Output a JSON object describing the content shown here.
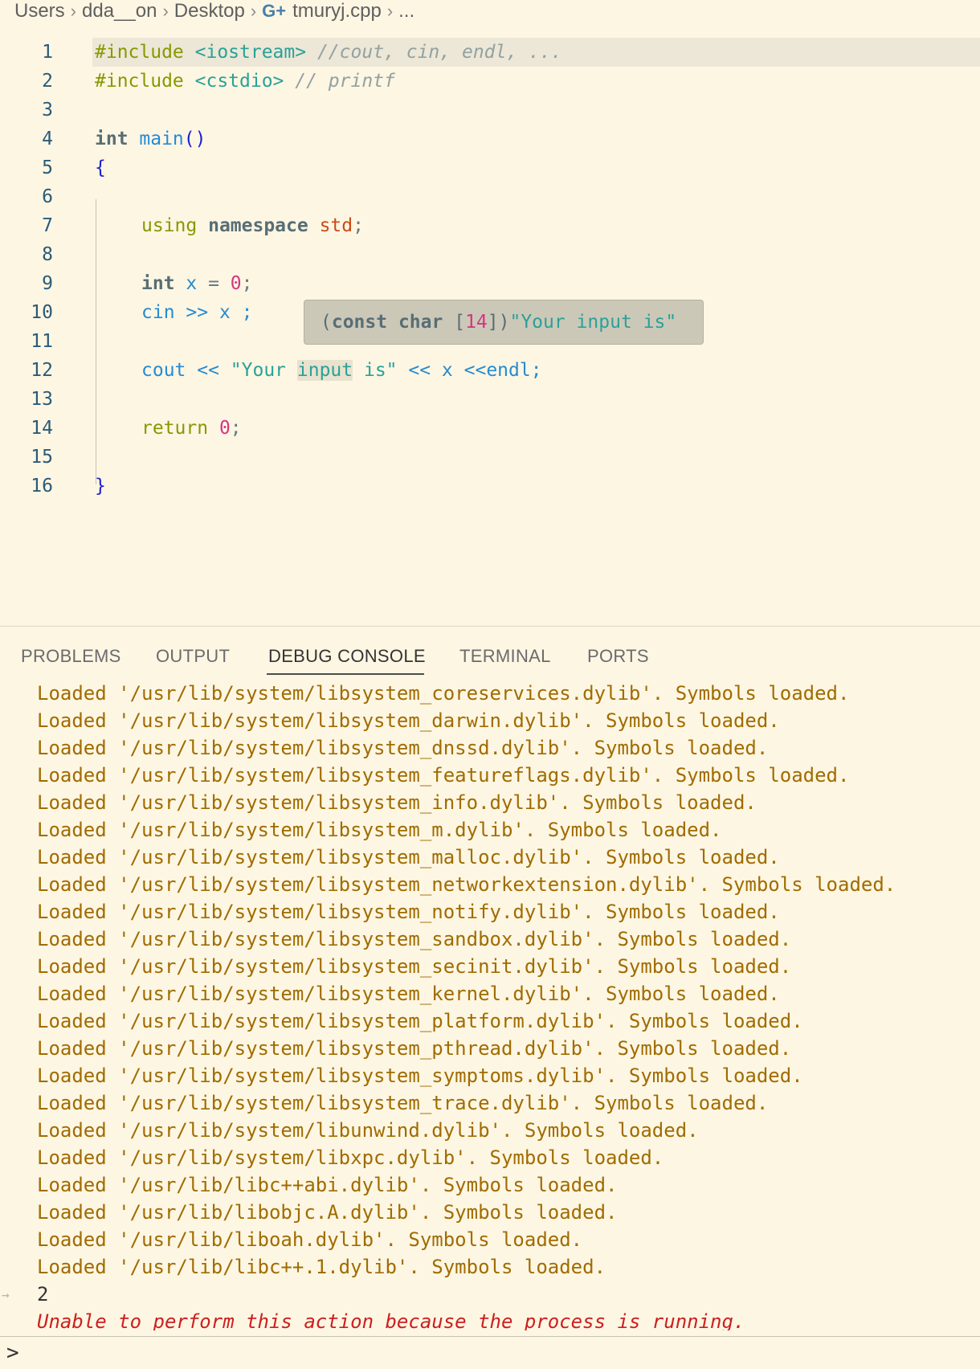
{
  "breadcrumb": {
    "items": [
      "Users",
      "dda__on",
      "Desktop"
    ],
    "file_icon": "cpp-file-icon",
    "file_icon_glyph": "G+",
    "file": "tmuryj.cpp",
    "ellipsis": "..."
  },
  "editor": {
    "line_numbers": [
      "1",
      "2",
      "3",
      "4",
      "5",
      "6",
      "7",
      "8",
      "9",
      "10",
      "11",
      "12",
      "13",
      "14",
      "15",
      "16"
    ],
    "lines": {
      "l1": {
        "pre": "#include",
        "inc": " <iostream>",
        "com": " //cout, cin, endl, ..."
      },
      "l2": {
        "pre": "#include",
        "inc": " <cstdio>",
        "com": " // printf"
      },
      "l4": {
        "kw": "int",
        "fn": " main",
        "br": "()"
      },
      "l5": {
        "br": "{"
      },
      "l7": {
        "kw2": "using",
        "kw": " namespace",
        "ns": " std",
        "op": ";"
      },
      "l9": {
        "kw": "int",
        "id": " x",
        "op": " = ",
        "num": "0",
        "op2": ";"
      },
      "l10": {
        "id": "cin",
        "op": " >> ",
        "id2": "x",
        "op2": " ;"
      },
      "l12": {
        "id": "cout",
        "op": " << ",
        "str": "\"Your ",
        "hl": "input",
        "str2": " is\"",
        "op2": " << ",
        "id2": "x",
        "op3": " <<",
        "id3": "endl",
        "op4": ";"
      },
      "l14": {
        "kw2": "return",
        "num": " 0",
        "op": ";"
      },
      "l16": {
        "br": "}"
      }
    },
    "hover": {
      "open": "(",
      "type": "const char",
      "sp": " ",
      "lb": "[",
      "num": "14",
      "rb": "])",
      "str": "\"Your input is\""
    }
  },
  "panel": {
    "tabs": [
      "PROBLEMS",
      "OUTPUT",
      "DEBUG CONSOLE",
      "TERMINAL",
      "PORTS"
    ],
    "active_tab": "DEBUG CONSOLE",
    "console_lines": [
      "Loaded '/usr/lib/system/libsystem_coreservices.dylib'. Symbols loaded.",
      "Loaded '/usr/lib/system/libsystem_darwin.dylib'. Symbols loaded.",
      "Loaded '/usr/lib/system/libsystem_dnssd.dylib'. Symbols loaded.",
      "Loaded '/usr/lib/system/libsystem_featureflags.dylib'. Symbols loaded.",
      "Loaded '/usr/lib/system/libsystem_info.dylib'. Symbols loaded.",
      "Loaded '/usr/lib/system/libsystem_m.dylib'. Symbols loaded.",
      "Loaded '/usr/lib/system/libsystem_malloc.dylib'. Symbols loaded.",
      "Loaded '/usr/lib/system/libsystem_networkextension.dylib'. Symbols loaded.",
      "Loaded '/usr/lib/system/libsystem_notify.dylib'. Symbols loaded.",
      "Loaded '/usr/lib/system/libsystem_sandbox.dylib'. Symbols loaded.",
      "Loaded '/usr/lib/system/libsystem_secinit.dylib'. Symbols loaded.",
      "Loaded '/usr/lib/system/libsystem_kernel.dylib'. Symbols loaded.",
      "Loaded '/usr/lib/system/libsystem_platform.dylib'. Symbols loaded.",
      "Loaded '/usr/lib/system/libsystem_pthread.dylib'. Symbols loaded.",
      "Loaded '/usr/lib/system/libsystem_symptoms.dylib'. Symbols loaded.",
      "Loaded '/usr/lib/system/libsystem_trace.dylib'. Symbols loaded.",
      "Loaded '/usr/lib/system/libunwind.dylib'. Symbols loaded.",
      "Loaded '/usr/lib/system/libxpc.dylib'. Symbols loaded.",
      "Loaded '/usr/lib/libc++abi.dylib'. Symbols loaded.",
      "Loaded '/usr/lib/libobjc.A.dylib'. Symbols loaded.",
      "Loaded '/usr/lib/liboah.dylib'. Symbols loaded.",
      "Loaded '/usr/lib/libc++.1.dylib'. Symbols loaded."
    ],
    "input_echo_arrow": "→",
    "input_echo": "2",
    "error_message": "Unable to perform this action because the process is running.",
    "prompt_glyph": ">",
    "prompt_value": ""
  },
  "colors": {
    "background": "#fdf6e3",
    "console_text": "#a06c00",
    "error_text": "#cc1f1f"
  }
}
